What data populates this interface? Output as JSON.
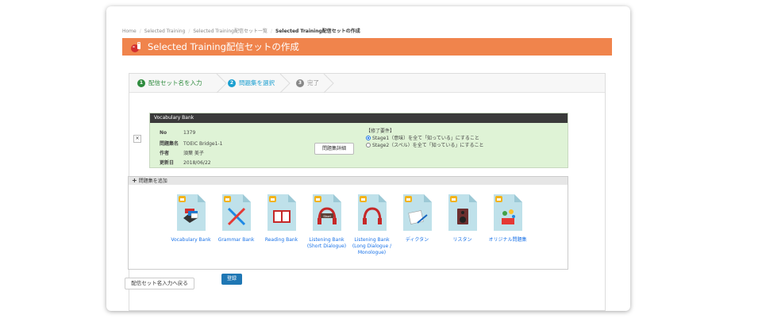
{
  "breadcrumb": {
    "items": [
      "Home",
      "Selected Training",
      "Selected Training配信セット一覧"
    ],
    "current": "Selected Training配信セットの作成"
  },
  "title_bar": {
    "title": "Selected Training配信セットの作成",
    "color": "#f0844c"
  },
  "steps": [
    {
      "num": "1",
      "label": "配信セット名を入力",
      "state": "done",
      "color": "#2e8b3d"
    },
    {
      "num": "2",
      "label": "問題集を選択",
      "state": "active",
      "color": "#1a9fd0"
    },
    {
      "num": "3",
      "label": "完了",
      "state": "pending",
      "color": "#888888"
    }
  ],
  "vocab_card": {
    "header": "Vocabulary Bank",
    "rows": [
      {
        "key": "No",
        "value": "1379"
      },
      {
        "key": "問題集名",
        "value": "TOEIC Bridge1-1"
      },
      {
        "key": "作者",
        "value": "須葉 美子"
      },
      {
        "key": "更新日",
        "value": "2018/06/22"
      }
    ],
    "detail_button": "問題集詳細",
    "requirement_title": "【修了要件】",
    "requirements": [
      {
        "label": "Stage1（意味）を全て「知っている」にすること",
        "selected": true
      },
      {
        "label": "Stage2（スペル）を全て「知っている」にすること",
        "selected": false
      }
    ],
    "remove_label": "×"
  },
  "add_section": {
    "header_plus": "+",
    "header": "問題集を追加",
    "books": [
      {
        "lines": [
          "Vocabulary Bank"
        ],
        "icon": "vocabulary-flags-icon"
      },
      {
        "lines": [
          "Grammar Bank"
        ],
        "icon": "ruler-pencil-icon"
      },
      {
        "lines": [
          "Reading Bank"
        ],
        "icon": "open-book-icon"
      },
      {
        "lines": [
          "Listening Bank",
          "(Short Dialogue)"
        ],
        "icon": "headphones-short-icon"
      },
      {
        "lines": [
          "Listening Bank",
          "(Long Dialogue /",
          "Monologue)"
        ],
        "icon": "headphones-icon"
      },
      {
        "lines": [
          "ディクタン"
        ],
        "icon": "paper-pen-icon"
      },
      {
        "lines": [
          "リスタン"
        ],
        "icon": "speaker-icon"
      },
      {
        "lines": [
          "オリジナル問題集"
        ],
        "icon": "original-items-icon"
      }
    ]
  },
  "buttons": {
    "back": "配信セット名入力へ戻る",
    "save": "登録"
  }
}
